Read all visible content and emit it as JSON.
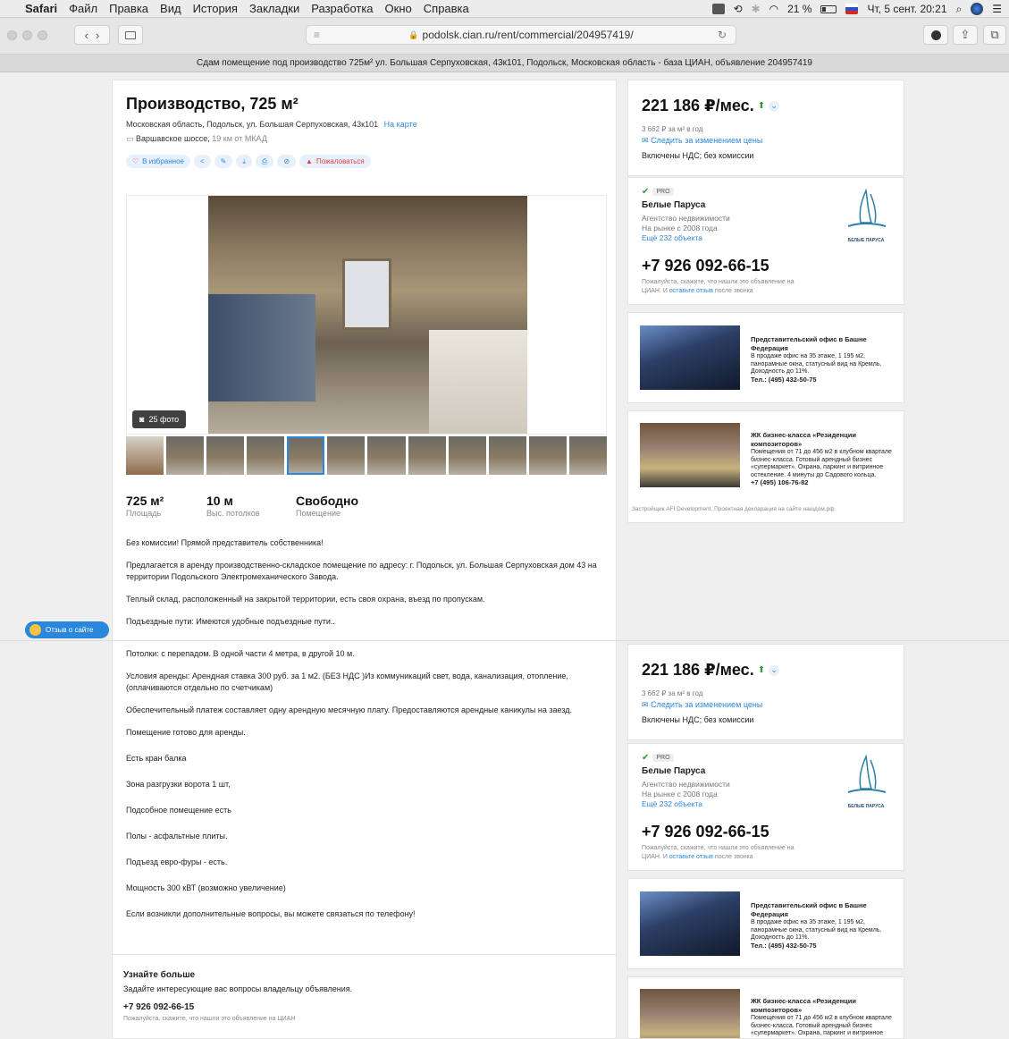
{
  "menubar": {
    "app": "Safari",
    "items": [
      "Файл",
      "Правка",
      "Вид",
      "История",
      "Закладки",
      "Разработка",
      "Окно",
      "Справка"
    ],
    "battery": "21 %",
    "datetime": "Чт, 5 сент.  20:21"
  },
  "browser": {
    "url": "podolsk.cian.ru/rent/commercial/204957419/",
    "tab_title": "Сдам помещение под производство 725м² ул. Большая Серпуховская, 43к101, Подольск, Московская область - база ЦИАН, объявление 204957419"
  },
  "listing": {
    "title": "Производство, 725 м²",
    "address": "Московская область, Подольск, ул. Большая Серпуховская, 43к101",
    "map_link": "На карте",
    "highway": "Варшавское шоссе,",
    "distance": "19 км от МКАД",
    "favorite": "В избранное",
    "complain": "Пожаловаться",
    "photo_count": "25 фото",
    "stats": [
      {
        "value": "725 м²",
        "label": "Площадь"
      },
      {
        "value": "10 м",
        "label": "Выс. потолков"
      },
      {
        "value": "Свободно",
        "label": "Помещение"
      }
    ],
    "description_top": [
      "Без комиссии! Прямой представитель собственника!",
      "Предлагается в аренду производственно-складское помещение по адресу: г. Подольск, ул. Большая Серпуховская дом 43 на территории Подольского Электромеханического Завода.",
      "Теплый склад, расположенный на закрытой территории, есть своя охрана, въезд по пропускам.",
      "Подъездные пути: Имеются удобные подъездные пути.."
    ],
    "description_bottom": [
      "Потолки: с перепадом. В одной части 4 метра, в другой 10 м.",
      "Условия аренды: Арендная ставка 300 руб. за 1 м2. (БЕЗ НДС )Из коммуникаций свет, вода, канализация, отопление, (оплачиваются отдельно по счетчикам)",
      "Обеспечительный платеж составляет одну арендную месячную плату. Предоставляются арендные каникулы на заезд.",
      "Помещение готово для аренды.",
      "Есть кран балка",
      "Зона разгрузки ворота 1 шт,",
      "Подсобное помещение есть",
      "Полы - асфальтные плиты.",
      "Подъезд евро-фуры - есть.",
      "Мощность 300 кВТ (возможно увеличение)",
      "Если возникли дополнительные вопросы, вы можете связаться по телефону!"
    ],
    "learn_more": {
      "title": "Узнайте больше",
      "text": "Задайте интересующие вас вопросы владельцу объявления.",
      "phone": "+7 926 092-66-15",
      "note": "Пожалуйста, скажите, что нашли это объявление на ЦИАН"
    }
  },
  "price_box": {
    "price": "221 186 ₽/мес.",
    "per_meter": "3 662 ₽ за м² в год",
    "follow": "Следить за изменением цены",
    "vat": "Включены НДС; без комиссии"
  },
  "agent": {
    "badge": "PRO",
    "name": "Белые Паруса",
    "type": "Агентство недвижимости",
    "since": "На рынке с 2008 года",
    "more": "Ещё 232 объекта",
    "phone": "+7 926 092-66-15",
    "note1": "Пожалуйста, скажите, что нашли это объявление на",
    "note2a": "ЦИАН. И",
    "note2b": "оставьте отзыв",
    "note2c": "после звонка",
    "logo_text": "БЕЛЫЕ ПАРУСА"
  },
  "ads": [
    {
      "title": "Представительский офис в Башне Федерация",
      "text": "В продаже офис на 35 этаже, 1 195 м2, панорамные окна, статусный вид на Кремль. Доходность до 11%.",
      "tel": "Тел.: (495) 432-50-75"
    },
    {
      "title": "ЖК бизнес-класса «Резиденции композиторов»",
      "text": "Помещения от 71 до 456 м2 в клубном квартале бизнес-класса. Готовый арендный бизнес «супермаркет». Охрана, паркинг и витринное остекление. 4 минуты до Садового кольца.",
      "tel": "+7 (495) 106-76-82",
      "footer": "Застройщик AFI Development. Проектная декларация на сайте нашдом.рф"
    }
  ],
  "feedback_button": "Отзыв о сайте"
}
